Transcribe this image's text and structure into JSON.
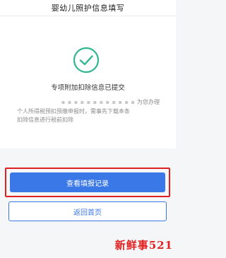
{
  "header": {
    "title": "婴幼儿照护信息填写"
  },
  "status": {
    "icon": "check-circle-icon",
    "title": "专项附加扣除信息已提交",
    "notice_lines": [
      "为您办理",
      "个人所得税预扣预缴申报时，需事先下载本条",
      "扣除信息进行税前扣除"
    ],
    "masked_text": "▪ ▪ ▪ ▪ ▪ ▪ ▪ ▪ ▪ ▪ ▪ ▪"
  },
  "actions": {
    "view_records": "查看填报记录",
    "back_home": "返回首页"
  },
  "colors": {
    "primary": "#3b78e7",
    "success": "#2fb78f",
    "highlight": "#e02020"
  },
  "watermark": "新鲜事521"
}
